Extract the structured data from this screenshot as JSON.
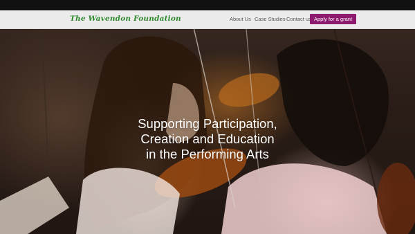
{
  "logo": {
    "text": "The Wavendon Foundation"
  },
  "nav": {
    "about": "About Us",
    "case_studies": "Case Studies",
    "contact": "Contact us",
    "apply": "Apply for a grant"
  },
  "hero": {
    "lines": [
      "Supporting Participation,",
      "Creation and Education",
      "in the Performing Arts"
    ]
  },
  "colors": {
    "logo_green": "#2f8a2f",
    "apply_button": "#8e1a6f",
    "navbar_bg": "#ececec"
  }
}
